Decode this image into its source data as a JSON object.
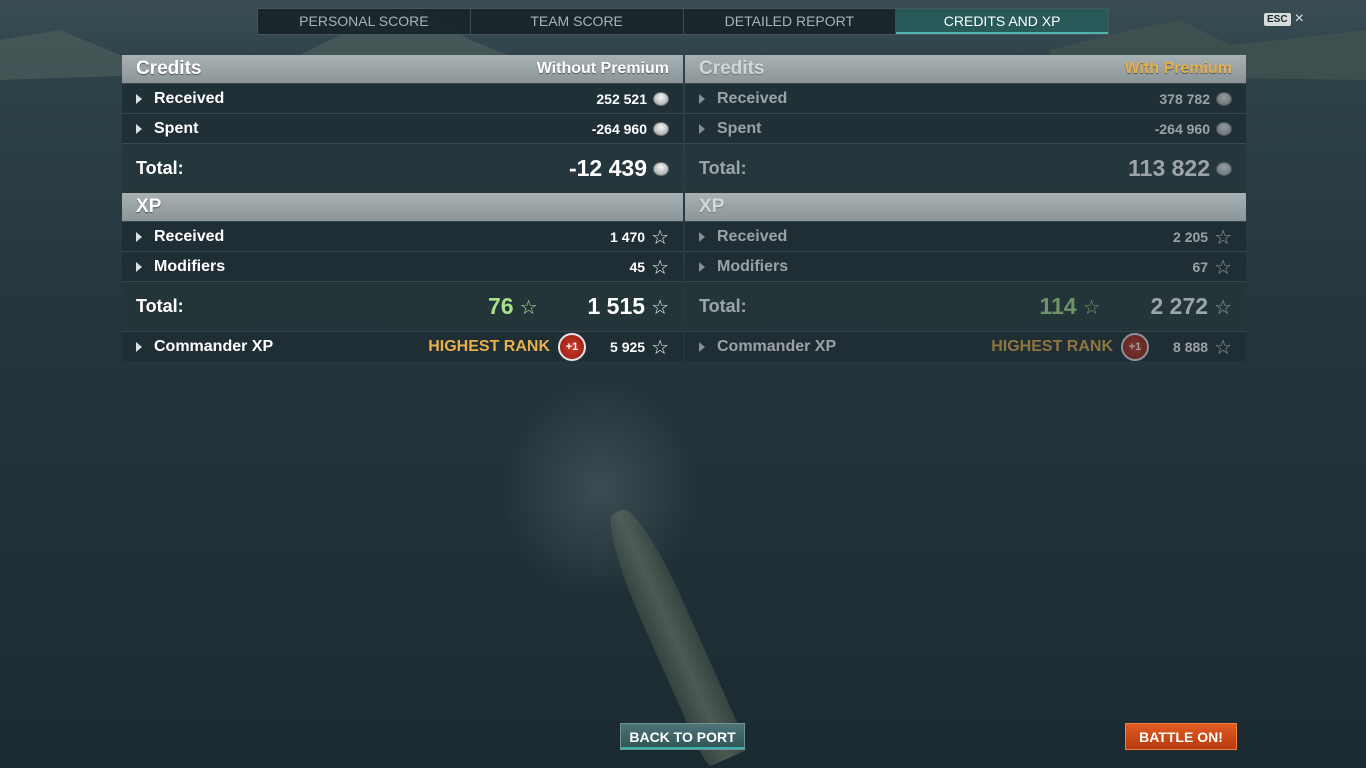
{
  "tabs": [
    "PERSONAL SCORE",
    "TEAM SCORE",
    "DETAILED REPORT",
    "CREDITS AND XP"
  ],
  "esc": {
    "key": "ESC",
    "close_icon": "×"
  },
  "left": {
    "credits": {
      "title": "Credits",
      "subtitle": "Without Premium",
      "received_label": "Received",
      "received_value": "252 521",
      "spent_label": "Spent",
      "spent_value": "-264 960",
      "total_label": "Total:",
      "total_value": "-12 439"
    },
    "xp": {
      "title": "XP",
      "received_label": "Received",
      "received_value": "1 470",
      "modifiers_label": "Modifiers",
      "modifiers_value": "45",
      "total_label": "Total:",
      "free_xp": "76",
      "total_value": "1 515",
      "commander_label": "Commander XP",
      "rank_text": "HIGHEST RANK",
      "rank_badge": "+1",
      "commander_value": "5 925"
    }
  },
  "right": {
    "credits": {
      "title": "Credits",
      "subtitle": "With Premium",
      "received_label": "Received",
      "received_value": "378 782",
      "spent_label": "Spent",
      "spent_value": "-264 960",
      "total_label": "Total:",
      "total_value": "113 822"
    },
    "xp": {
      "title": "XP",
      "received_label": "Received",
      "received_value": "2 205",
      "modifiers_label": "Modifiers",
      "modifiers_value": "67",
      "total_label": "Total:",
      "free_xp": "114",
      "total_value": "2 272",
      "commander_label": "Commander XP",
      "rank_text": "HIGHEST RANK",
      "rank_badge": "+1",
      "commander_value": "8 888"
    }
  },
  "icons": {
    "star": "☆"
  },
  "buttons": {
    "back_to_port": "BACK TO PORT",
    "battle_on": "BATTLE ON!"
  }
}
